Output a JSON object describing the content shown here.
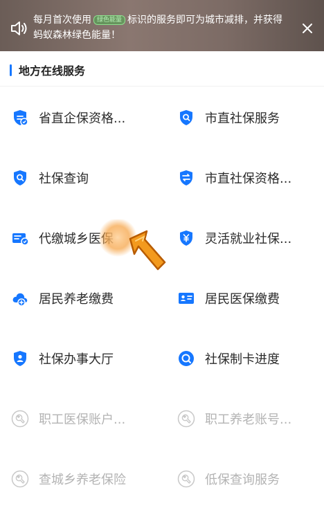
{
  "banner": {
    "text_before": "每月首次使用",
    "tag": "绿色能量",
    "text_after": "标识的服务即可为城市减排，并获得蚂蚁森林绿色能量！",
    "speaker_icon": "speaker-icon",
    "close_icon": "close-icon"
  },
  "section": {
    "title": "地方在线服务"
  },
  "services": [
    {
      "label": "省直企保资格...",
      "icon": "enterprise-shield-icon"
    },
    {
      "label": "市直社保服务",
      "icon": "shield-search-icon"
    },
    {
      "label": "社保查询",
      "icon": "shield-search-icon"
    },
    {
      "label": "市直社保资格...",
      "icon": "shield-swap-icon"
    },
    {
      "label": "代缴城乡医保",
      "icon": "card-check-icon"
    },
    {
      "label": "灵活就业社保...",
      "icon": "shield-yuan-icon"
    },
    {
      "label": "居民养老缴费",
      "icon": "cloud-plus-icon"
    },
    {
      "label": "居民医保缴费",
      "icon": "id-card-icon"
    },
    {
      "label": "社保办事大厅",
      "icon": "shield-person-icon"
    },
    {
      "label": "社保制卡进度",
      "icon": "circle-progress-icon"
    },
    {
      "label": "职工医保账户...",
      "icon": "wrench-icon"
    },
    {
      "label": "职工养老账号...",
      "icon": "wrench-icon"
    },
    {
      "label": "查城乡养老保险",
      "icon": "wrench-icon"
    },
    {
      "label": "低保查询服务",
      "icon": "wrench-icon"
    }
  ],
  "colors": {
    "accent": "#1677ff",
    "pointer": "#f39a1e",
    "disabled": "#c8c8c8"
  }
}
